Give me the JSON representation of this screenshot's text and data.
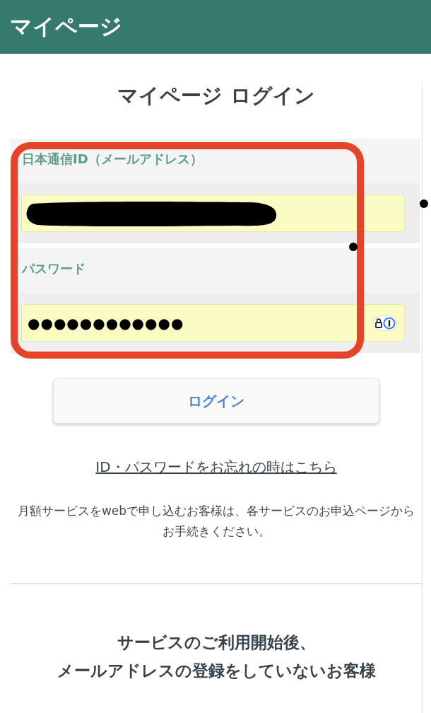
{
  "header": {
    "title": "マイページ"
  },
  "heading": "マイページ ログイン",
  "fields": [
    {
      "label": "日本通信ID（メールアドレス）",
      "kind": "redacted"
    },
    {
      "label": "パスワード",
      "kind": "password",
      "value": "●●●●●●●●●●●●"
    }
  ],
  "login_button": "ログイン",
  "forgot_link": "ID・パスワードをお忘れの時はこちら",
  "notice": "月額サービスをwebで申し込むお客様は、各サービスのお申込ページからお手続きください。",
  "section_heading": [
    "サービスのご利用開始後、",
    "メールアドレスの登録をしていないお客様"
  ]
}
